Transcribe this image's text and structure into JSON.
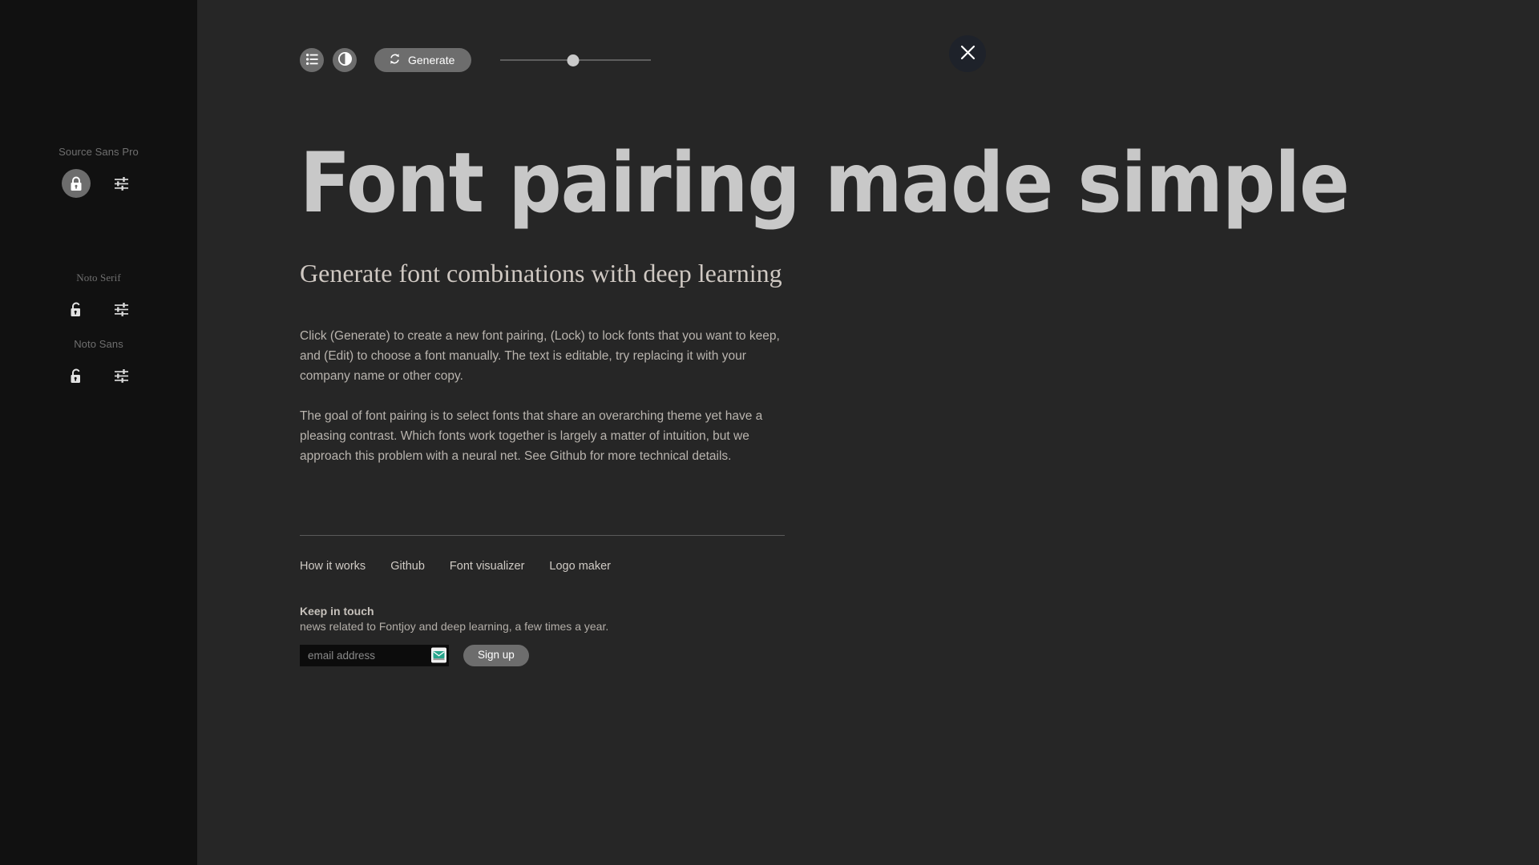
{
  "theme": {
    "sidebar_bg": "#111111",
    "main_bg": "#262626",
    "accent_button": "#6d6d6d",
    "headline_color": "#c8c8c8",
    "body_color": "#b9b4ae",
    "envelope_teal": "#28a58c"
  },
  "toolbar": {
    "list_icon": "list-icon",
    "contrast_icon": "contrast-icon",
    "generate_icon": "refresh-icon",
    "generate_label": "Generate",
    "slider": {
      "name": "contrast-slider",
      "value_percent": 48
    },
    "close_icon": "close-icon"
  },
  "sidebar": {
    "fonts": [
      {
        "name": "Source Sans Pro",
        "locked": true,
        "lock_icon": "lock-closed-icon",
        "edit_icon": "sliders-icon",
        "serif": false
      },
      {
        "name": "Noto Serif",
        "locked": false,
        "lock_icon": "lock-open-icon",
        "edit_icon": "sliders-icon",
        "serif": true
      },
      {
        "name": "Noto Sans",
        "locked": false,
        "lock_icon": "lock-open-icon",
        "edit_icon": "sliders-icon",
        "serif": false
      }
    ]
  },
  "main": {
    "headline": "Font pairing made simple",
    "subheadline": "Generate font combinations with deep learning",
    "paragraph_1": "Click (Generate) to create a new font pairing, (Lock) to lock fonts that you want to keep, and (Edit) to choose a font manually. The text is editable, try replacing it with your company name or other copy.",
    "paragraph_2": "The goal of font pairing is to select fonts that share an overarching theme yet have a pleasing contrast. Which fonts work together is largely a matter of intuition, but we approach this problem with a neural net. See Github for more technical details."
  },
  "footer": {
    "links": [
      {
        "label": "How it works"
      },
      {
        "label": "Github"
      },
      {
        "label": "Font visualizer"
      },
      {
        "label": "Logo maker"
      }
    ],
    "newsletter": {
      "title": "Keep in touch",
      "subtitle": "news related to Fontjoy and deep learning, a few times a year.",
      "email_placeholder": "email address",
      "email_value": "",
      "autofill_icon": "envelope-icon",
      "submit_label": "Sign up"
    }
  }
}
